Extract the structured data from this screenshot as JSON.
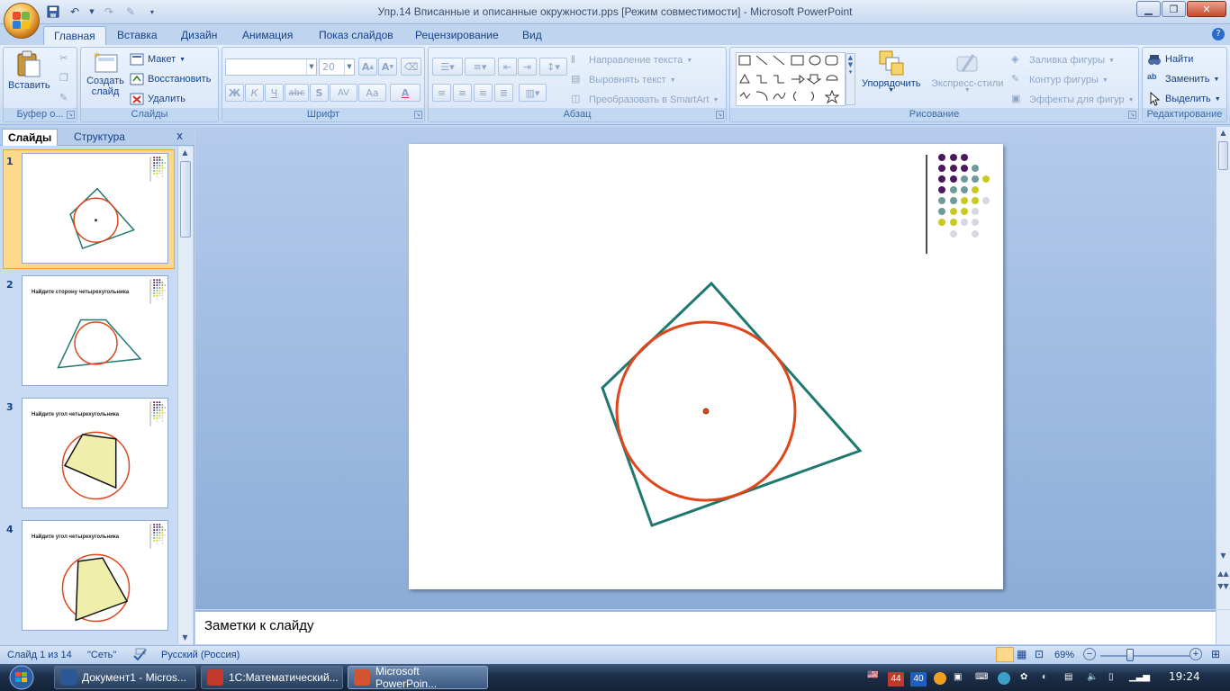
{
  "window": {
    "title": "Упр.14 Вписанные и описанные окружности.pps [Режим совместимости] - Microsoft PowerPoint",
    "controls": [
      "minimize",
      "maximize",
      "close"
    ]
  },
  "ribbon_tabs": [
    "Главная",
    "Вставка",
    "Дизайн",
    "Анимация",
    "Показ слайдов",
    "Рецензирование",
    "Вид"
  ],
  "active_tab": "Главная",
  "groups": {
    "clipboard": {
      "label": "Буфер о...",
      "paste": "Вставить"
    },
    "slides": {
      "label": "Слайды",
      "new_slide": "Создать слайд",
      "layout": "Макет",
      "reset": "Восстановить",
      "delete": "Удалить"
    },
    "font": {
      "label": "Шрифт",
      "font_name": "",
      "font_size": "20",
      "bold": "Ж",
      "italic": "К",
      "underline": "Ч",
      "strike": "abc",
      "shadow": "S",
      "spacing": "AV",
      "case": "Aa",
      "color": "A"
    },
    "paragraph": {
      "label": "Абзац",
      "text_direction": "Направление текста",
      "align_text": "Выровнять текст",
      "smartart": "Преобразовать в SmartArt"
    },
    "drawing": {
      "label": "Рисование",
      "arrange": "Упорядочить",
      "quick_styles": "Экспресс-стили",
      "fill": "Заливка фигуры",
      "outline": "Контур фигуры",
      "effects": "Эффекты для фигур"
    },
    "editing": {
      "label": "Редактирование",
      "find": "Найти",
      "replace": "Заменить",
      "select": "Выделить"
    }
  },
  "left_pane": {
    "tabs": [
      "Слайды",
      "Структура"
    ],
    "close": "x",
    "thumbnails": [
      {
        "num": "1",
        "title": ""
      },
      {
        "num": "2",
        "title": "Найдите сторону четырехугольника"
      },
      {
        "num": "3",
        "title": "Найдите угол четырехугольника"
      },
      {
        "num": "4",
        "title": "Найдите угол четырехугольника"
      }
    ]
  },
  "notes_placeholder": "Заметки к слайду",
  "status": {
    "slide": "Слайд 1 из 14",
    "theme": "\"Сеть\"",
    "language": "Русский (Россия)",
    "zoom": "69%",
    "zoom_percent": 69
  },
  "taskbar": {
    "tasks": [
      "Документ1 - Micros...",
      "1С:Математический...",
      "Microsoft PowerPoin..."
    ],
    "active": 2,
    "tray_badges": [
      "44",
      "40"
    ],
    "clock": "19:24"
  },
  "colors": {
    "circle": "#e0461a",
    "quadrilateral": "#1f7870",
    "center_dot": "#e0461a",
    "dot_purple": "#4b1a5e",
    "dot_teal": "#6f9a9a",
    "dot_yellow": "#c9c923",
    "dot_grey": "#d7d7e3"
  }
}
